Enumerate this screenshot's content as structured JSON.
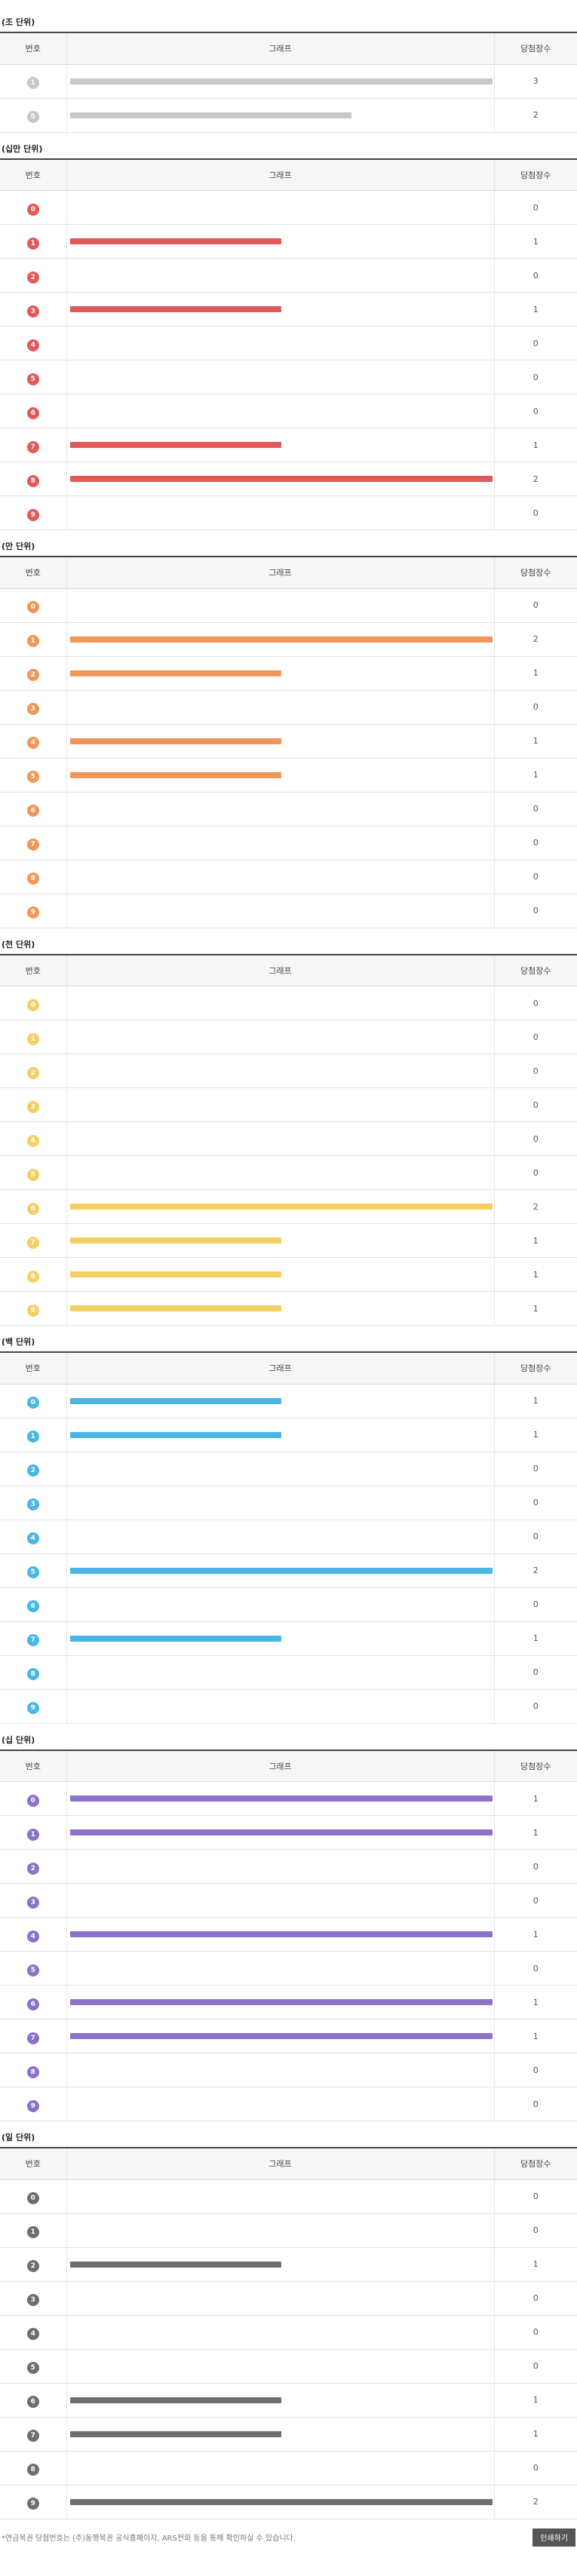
{
  "headers": {
    "number": "번호",
    "graph": "그래프",
    "count": "당첨장수"
  },
  "max_count": 2,
  "sections": [
    {
      "title": "(조 단위)",
      "color": "#c8c8c8",
      "text_color": "#ffffff",
      "rows": [
        {
          "num": "1",
          "count": 3
        },
        {
          "num": "5",
          "count": 2
        }
      ],
      "max": 3
    },
    {
      "title": "(십만 단위)",
      "color": "#e2595a",
      "text_color": "#ffffff",
      "rows": [
        {
          "num": "0",
          "count": 0
        },
        {
          "num": "1",
          "count": 1
        },
        {
          "num": "2",
          "count": 0
        },
        {
          "num": "3",
          "count": 1
        },
        {
          "num": "4",
          "count": 0
        },
        {
          "num": "5",
          "count": 0
        },
        {
          "num": "6",
          "count": 0
        },
        {
          "num": "7",
          "count": 1
        },
        {
          "num": "8",
          "count": 2
        },
        {
          "num": "9",
          "count": 0
        }
      ],
      "max": 2
    },
    {
      "title": "(만 단위)",
      "color": "#ef9658",
      "text_color": "#ffffff",
      "rows": [
        {
          "num": "0",
          "count": 0
        },
        {
          "num": "1",
          "count": 2
        },
        {
          "num": "2",
          "count": 1
        },
        {
          "num": "3",
          "count": 0
        },
        {
          "num": "4",
          "count": 1
        },
        {
          "num": "5",
          "count": 1
        },
        {
          "num": "6",
          "count": 0
        },
        {
          "num": "7",
          "count": 0
        },
        {
          "num": "8",
          "count": 0
        },
        {
          "num": "9",
          "count": 0
        }
      ],
      "max": 2
    },
    {
      "title": "(천 단위)",
      "color": "#f4cf62",
      "text_color": "#ffffff",
      "rows": [
        {
          "num": "0",
          "count": 0
        },
        {
          "num": "1",
          "count": 0
        },
        {
          "num": "2",
          "count": 0
        },
        {
          "num": "3",
          "count": 0
        },
        {
          "num": "4",
          "count": 0
        },
        {
          "num": "5",
          "count": 0
        },
        {
          "num": "6",
          "count": 2
        },
        {
          "num": "7",
          "count": 1
        },
        {
          "num": "8",
          "count": 1
        },
        {
          "num": "9",
          "count": 1
        }
      ],
      "max": 2
    },
    {
      "title": "(백 단위)",
      "color": "#4ab6e3",
      "text_color": "#ffffff",
      "rows": [
        {
          "num": "0",
          "count": 1
        },
        {
          "num": "1",
          "count": 1
        },
        {
          "num": "2",
          "count": 0
        },
        {
          "num": "3",
          "count": 0
        },
        {
          "num": "4",
          "count": 0
        },
        {
          "num": "5",
          "count": 2
        },
        {
          "num": "6",
          "count": 0
        },
        {
          "num": "7",
          "count": 1
        },
        {
          "num": "8",
          "count": 0
        },
        {
          "num": "9",
          "count": 0
        }
      ],
      "max": 2
    },
    {
      "title": "(십 단위)",
      "color": "#8a72c9",
      "text_color": "#ffffff",
      "rows": [
        {
          "num": "0",
          "count": 1
        },
        {
          "num": "1",
          "count": 1
        },
        {
          "num": "2",
          "count": 0
        },
        {
          "num": "3",
          "count": 0
        },
        {
          "num": "4",
          "count": 1
        },
        {
          "num": "5",
          "count": 0
        },
        {
          "num": "6",
          "count": 1
        },
        {
          "num": "7",
          "count": 1
        },
        {
          "num": "8",
          "count": 0
        },
        {
          "num": "9",
          "count": 0
        }
      ],
      "max": 1
    },
    {
      "title": "(일 단위)",
      "color": "#6e6e6e",
      "text_color": "#ffffff",
      "rows": [
        {
          "num": "0",
          "count": 0
        },
        {
          "num": "1",
          "count": 0
        },
        {
          "num": "2",
          "count": 1
        },
        {
          "num": "3",
          "count": 0
        },
        {
          "num": "4",
          "count": 0
        },
        {
          "num": "5",
          "count": 0
        },
        {
          "num": "6",
          "count": 1
        },
        {
          "num": "7",
          "count": 1
        },
        {
          "num": "8",
          "count": 0
        },
        {
          "num": "9",
          "count": 2
        }
      ],
      "max": 2
    }
  ],
  "footer": {
    "note": "*연금복권 당첨번호는 (주)동행복권 공식홈페이지, ARS전화 등을 통해 확인하실 수 있습니다.",
    "print_label": "인쇄하기"
  }
}
